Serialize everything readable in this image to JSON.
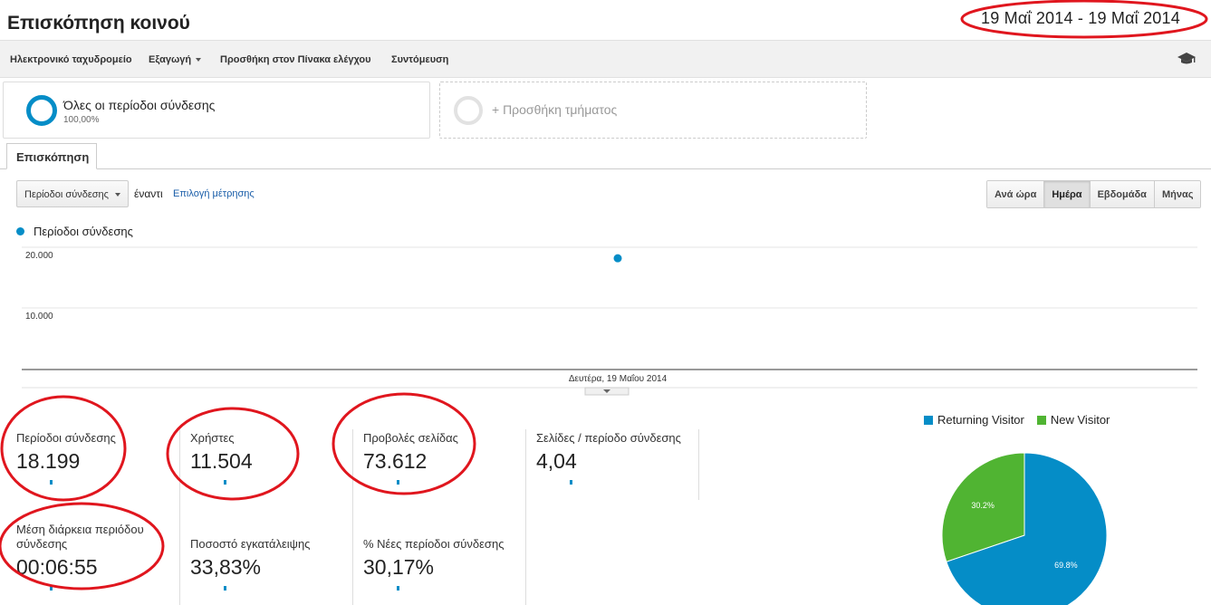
{
  "header": {
    "title": "Επισκόπηση κοινού",
    "date_range": "19 Μαΐ 2014 - 19 Μαΐ 2014"
  },
  "toolbar": {
    "email": "Ηλεκτρονικό ταχυδρομείο",
    "export": "Εξαγωγή",
    "add_dashboard": "Προσθήκη στον Πίνακα ελέγχου",
    "shortcut": "Συντόμευση",
    "icon": "graduation-cap-icon"
  },
  "segments": {
    "all_sessions": {
      "label": "Όλες οι περίοδοι σύνδεσης",
      "percent": "100,00%"
    },
    "add_segment": "+ Προσθήκη τμήματος"
  },
  "tab": {
    "label": "Επισκόπηση"
  },
  "controls": {
    "metric": "Περίοδοι σύνδεσης",
    "vs": "έναντι",
    "choose_metric": "Επιλογή μέτρησης",
    "granularity": [
      {
        "label": "Ανά ώρα",
        "active": false
      },
      {
        "label": "Ημέρα",
        "active": true
      },
      {
        "label": "Εβδομάδα",
        "active": false
      },
      {
        "label": "Μήνας",
        "active": false
      }
    ]
  },
  "legend": {
    "label": "Περίοδοι σύνδεσης"
  },
  "metrics": [
    {
      "label": "Περίοδοι σύνδεσης",
      "value": "18.199"
    },
    {
      "label": "Χρήστες",
      "value": "11.504"
    },
    {
      "label": "Προβολές σελίδας",
      "value": "73.612"
    },
    {
      "label": "Σελίδες / περίοδο σύνδεσης",
      "value": "4,04"
    },
    {
      "label": "Μέση διάρκεια περιόδου σύνδεσης",
      "value": "00:06:55"
    },
    {
      "label": "Ποσοστό εγκατάλειψης",
      "value": "33,83%"
    },
    {
      "label": "% Νέες περίοδοι σύνδεσης",
      "value": "30,17%"
    }
  ],
  "colors": {
    "accent": "#058dc7",
    "new_visitor": "#50b432",
    "annotation": "#e0161e"
  },
  "chart_data": [
    {
      "type": "line",
      "series": [
        {
          "name": "Περίοδοι σύνδεσης",
          "x": [
            "Δευτέρα, 19 Μαΐου 2014"
          ],
          "values": [
            18199
          ]
        }
      ],
      "x_label": "Δευτέρα, 19 Μαΐου 2014",
      "y_ticks": [
        "20.000",
        "10.000"
      ],
      "ylim": [
        0,
        20000
      ],
      "grid": true,
      "legend": "top-left"
    },
    {
      "type": "pie",
      "labels": [
        "Returning Visitor",
        "New Visitor"
      ],
      "values": [
        69.8,
        30.2
      ],
      "slice_labels": [
        "69.8%",
        "30.2%"
      ],
      "colors": [
        "#058dc7",
        "#50b432"
      ],
      "legend": "top"
    }
  ]
}
